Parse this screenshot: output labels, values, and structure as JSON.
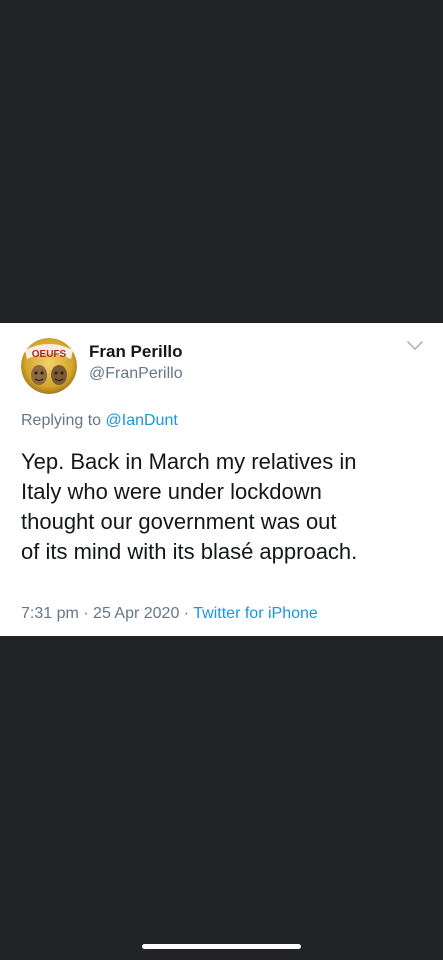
{
  "tweet": {
    "display_name": "Fran Perillo",
    "handle": "@FranPerillo",
    "avatar_text": "OEUFS",
    "reply_prefix": "Replying to",
    "reply_to": "@IanDunt",
    "lines": [
      "Yep. Back in March my relatives in",
      "Italy who were under lockdown",
      "thought our government was out",
      "of its mind with its blasé approach."
    ],
    "time": "7:31 pm",
    "date": "25 Apr 2020",
    "source": "Twitter for iPhone",
    "separator": "·"
  },
  "colors": {
    "background": "#222326",
    "card": "#ffffff",
    "text": "#14171a",
    "secondary": "#657786",
    "link": "#1b95e0"
  },
  "icons": {
    "menu": "chevron-down-icon"
  }
}
